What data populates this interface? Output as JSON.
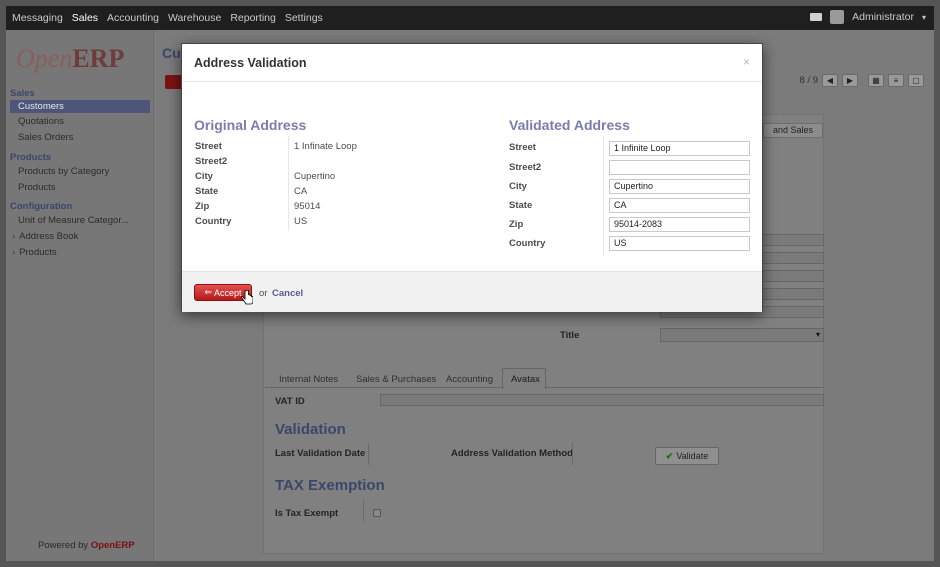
{
  "topbar": {
    "menu": [
      "Messaging",
      "Sales",
      "Accounting",
      "Warehouse",
      "Reporting",
      "Settings"
    ],
    "active": "Sales",
    "user": "Administrator"
  },
  "sidebar": {
    "logo_open": "Open",
    "logo_erp": "ERP",
    "sections": [
      {
        "title": "Sales",
        "items": [
          "Customers",
          "Quotations",
          "Sales Orders"
        ]
      },
      {
        "title": "Products",
        "items": [
          "Products by Category",
          "Products"
        ]
      },
      {
        "title": "Configuration",
        "items": [
          "Unit of Measure Categor...",
          "Address Book",
          "Products"
        ]
      }
    ],
    "selected": "Customers",
    "powered_prefix": "Powered by",
    "powered_brand": "OpenERP"
  },
  "background": {
    "page_title": "Cu",
    "pager": "8 / 9",
    "top_button": "and Sales",
    "title_label": "Title",
    "tabs": [
      "Internal Notes",
      "Sales & Purchases",
      "Accounting",
      "Avatax"
    ],
    "active_tab": "Avatax",
    "vat_label": "VAT ID",
    "validation_heading": "Validation",
    "last_validation_label": "Last Validation Date",
    "address_method_label": "Address Validation Method",
    "validate_button": "Validate",
    "tax_heading": "TAX Exemption",
    "tax_exempt_label": "Is Tax Exempt"
  },
  "modal": {
    "title": "Address Validation",
    "close": "×",
    "original_heading": "Original Address",
    "validated_heading": "Validated Address",
    "original": [
      {
        "label": "Street",
        "value": "1 Infinate Loop"
      },
      {
        "label": "Street2",
        "value": ""
      },
      {
        "label": "City",
        "value": "Cupertino"
      },
      {
        "label": "State",
        "value": "CA"
      },
      {
        "label": "Zip",
        "value": "95014"
      },
      {
        "label": "Country",
        "value": "US"
      }
    ],
    "validated": [
      {
        "label": "Street",
        "value": "1 Infinite Loop"
      },
      {
        "label": "Street2",
        "value": ""
      },
      {
        "label": "City",
        "value": "Cupertino"
      },
      {
        "label": "State",
        "value": "CA"
      },
      {
        "label": "Zip",
        "value": "95014-2083"
      },
      {
        "label": "Country",
        "value": "US"
      }
    ],
    "accept_button": "Accept",
    "or_text": "or",
    "cancel_link": "Cancel"
  },
  "colors": {
    "accent_heading": "#7c7bad",
    "accept_red": "#c62828",
    "brand_red": "#7a1010"
  }
}
